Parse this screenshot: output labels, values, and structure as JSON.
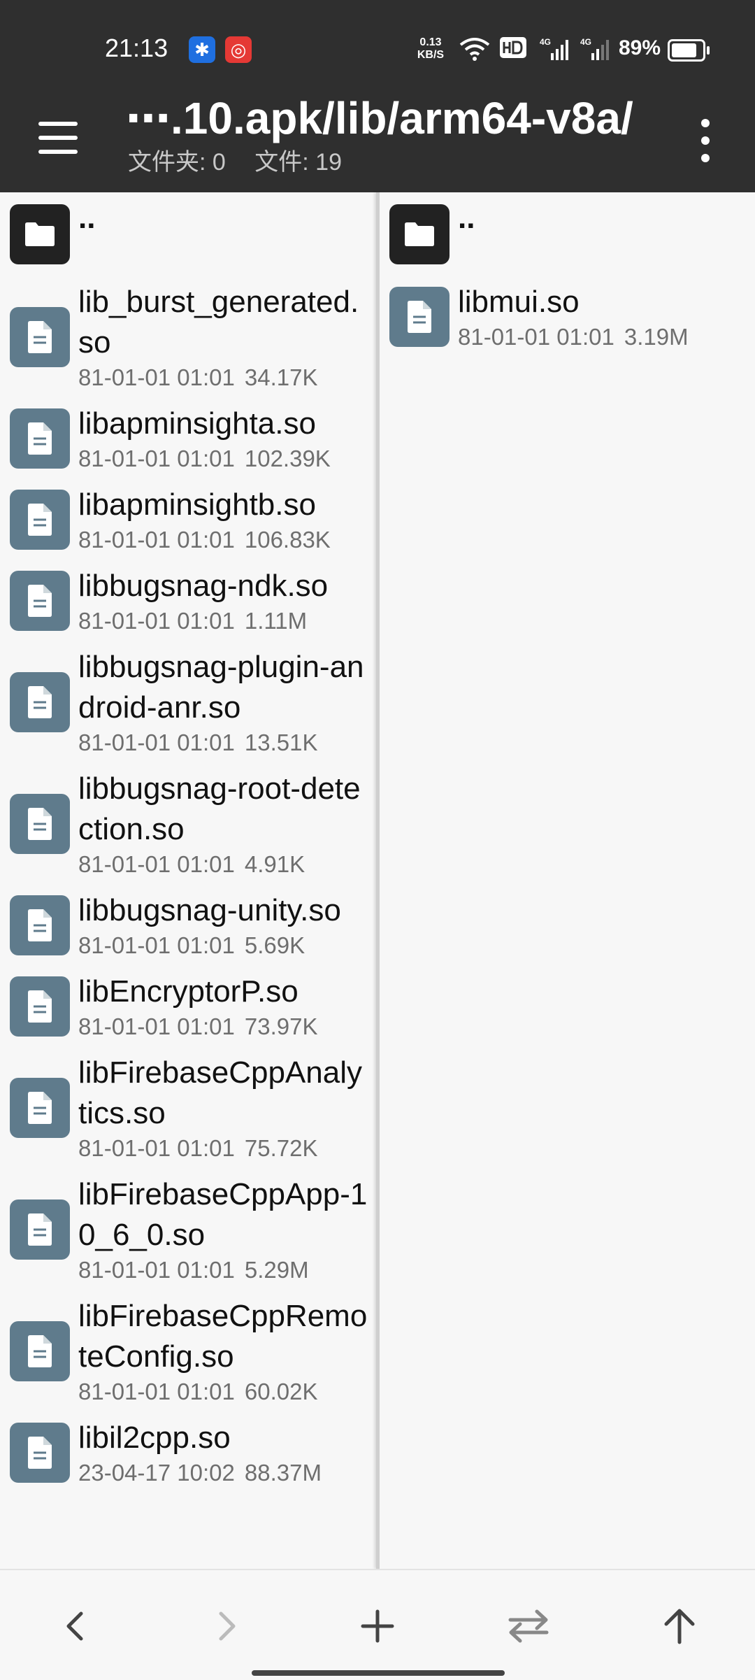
{
  "status_bar": {
    "time": "21:13",
    "net_speed_value": "0.13",
    "net_speed_unit": "KB/S",
    "battery_percent": "89%",
    "battery_level": 0.89,
    "icons": [
      "notification-app-blue-icon",
      "netease-music-icon",
      "wifi-icon",
      "hd-icon",
      "signal-4g-icon",
      "signal-4g-icon-2",
      "battery-icon"
    ]
  },
  "app_bar": {
    "path": "⋯.10.apk/lib/arm64-v8a/",
    "folders_label": "文件夹: 0",
    "files_label": "文件: 19"
  },
  "left_pane": {
    "up_label": "..",
    "files": [
      {
        "name": "lib_burst_generated.so",
        "date": "81-01-01 01:01",
        "size": "34.17K"
      },
      {
        "name": "libapminsighta.so",
        "date": "81-01-01 01:01",
        "size": "102.39K"
      },
      {
        "name": "libapminsightb.so",
        "date": "81-01-01 01:01",
        "size": "106.83K"
      },
      {
        "name": "libbugsnag-ndk.so",
        "date": "81-01-01 01:01",
        "size": "1.11M"
      },
      {
        "name": "libbugsnag-plugin-android-anr.so",
        "date": "81-01-01 01:01",
        "size": "13.51K"
      },
      {
        "name": "libbugsnag-root-detection.so",
        "date": "81-01-01 01:01",
        "size": "4.91K"
      },
      {
        "name": "libbugsnag-unity.so",
        "date": "81-01-01 01:01",
        "size": "5.69K"
      },
      {
        "name": "libEncryptorP.so",
        "date": "81-01-01 01:01",
        "size": "73.97K"
      },
      {
        "name": "libFirebaseCppAnalytics.so",
        "date": "81-01-01 01:01",
        "size": "75.72K"
      },
      {
        "name": "libFirebaseCppApp-10_6_0.so",
        "date": "81-01-01 01:01",
        "size": "5.29M"
      },
      {
        "name": "libFirebaseCppRemoteConfig.so",
        "date": "81-01-01 01:01",
        "size": "60.02K"
      },
      {
        "name": "libil2cpp.so",
        "date": "23-04-17 10:02",
        "size": "88.37M"
      }
    ]
  },
  "right_pane": {
    "up_label": "..",
    "files": [
      {
        "name": "libmui.so",
        "date": "81-01-01 01:01",
        "size": "3.19M"
      }
    ]
  },
  "bottom_bar": {
    "buttons": [
      "back-icon",
      "forward-icon",
      "add-icon",
      "swap-panes-icon",
      "go-up-icon"
    ]
  },
  "colors": {
    "topbar": "#2f2f2f",
    "file_tile": "#5f7b8c",
    "folder_tile": "#222222",
    "background": "#f7f7f7"
  }
}
